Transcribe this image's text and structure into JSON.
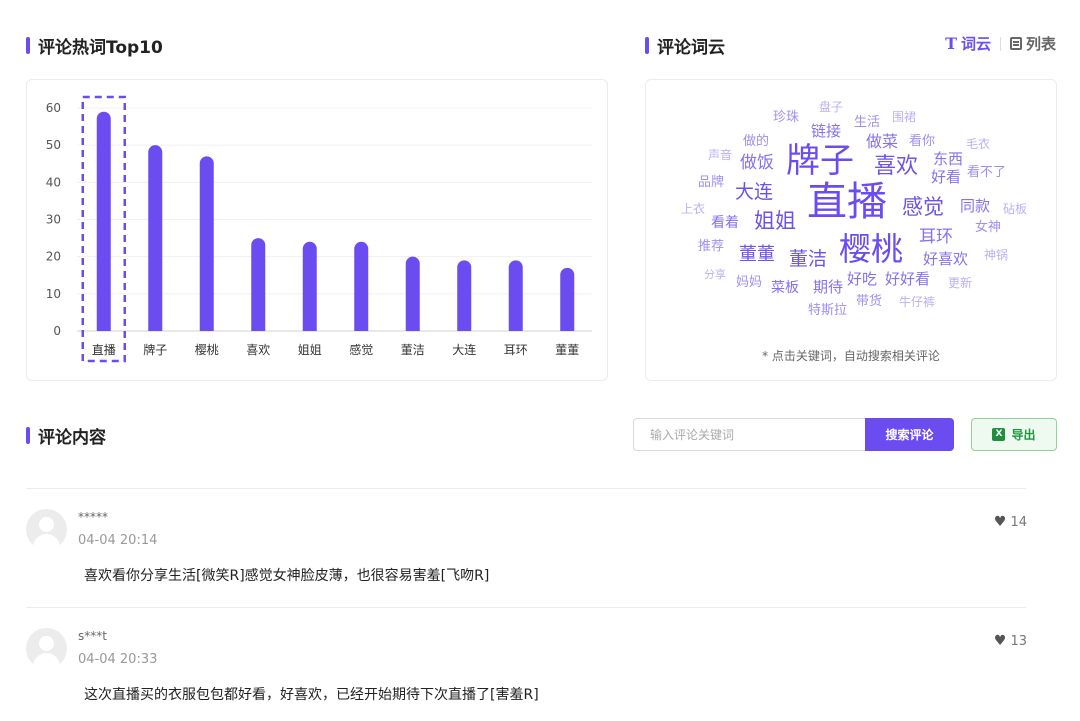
{
  "colors": {
    "accent": "#6a4cf0",
    "export_green": "#1a9a3c"
  },
  "top10": {
    "title": "评论热词Top10",
    "chart_data": {
      "type": "bar",
      "categories": [
        "直播",
        "牌子",
        "樱桃",
        "喜欢",
        "姐姐",
        "感觉",
        "董洁",
        "大连",
        "耳环",
        "董董"
      ],
      "values": [
        59,
        50,
        47,
        25,
        24,
        24,
        20,
        19,
        19,
        17
      ],
      "yticks": [
        0,
        10,
        20,
        30,
        40,
        50,
        60
      ],
      "ylim": [
        0,
        60
      ],
      "highlighted_category": "直播",
      "bar_color": "#6a4cf0",
      "grid": true
    }
  },
  "cloud": {
    "title": "评论词云",
    "toggle": {
      "cloud_label": "词云",
      "list_label": "列表",
      "active": "cloud",
      "cloud_icon": "T",
      "list_icon": "list-icon"
    },
    "note": "* 点击关键词，自动搜索相关评论",
    "words": [
      {
        "text": "直播",
        "size": 40,
        "weight": 5
      },
      {
        "text": "牌子",
        "size": 34,
        "weight": 5
      },
      {
        "text": "樱桃",
        "size": 32,
        "weight": 5
      },
      {
        "text": "喜欢",
        "size": 22,
        "weight": 4
      },
      {
        "text": "感觉",
        "size": 21,
        "weight": 4
      },
      {
        "text": "姐姐",
        "size": 21,
        "weight": 4
      },
      {
        "text": "大连",
        "size": 19,
        "weight": 4
      },
      {
        "text": "董洁",
        "size": 19,
        "weight": 4
      },
      {
        "text": "董董",
        "size": 18,
        "weight": 4
      },
      {
        "text": "耳环",
        "size": 17,
        "weight": 3
      },
      {
        "text": "做饭",
        "size": 17,
        "weight": 3
      },
      {
        "text": "做菜",
        "size": 16,
        "weight": 3
      },
      {
        "text": "好看",
        "size": 15,
        "weight": 3
      },
      {
        "text": "好喜欢",
        "size": 15,
        "weight": 3
      },
      {
        "text": "东西",
        "size": 15,
        "weight": 3
      },
      {
        "text": "链接",
        "size": 15,
        "weight": 3
      },
      {
        "text": "好吃",
        "size": 15,
        "weight": 3
      },
      {
        "text": "好好看",
        "size": 15,
        "weight": 3
      },
      {
        "text": "期待",
        "size": 15,
        "weight": 3
      },
      {
        "text": "同款",
        "size": 15,
        "weight": 3
      },
      {
        "text": "看着",
        "size": 14,
        "weight": 3
      },
      {
        "text": "菜板",
        "size": 14,
        "weight": 3
      },
      {
        "text": "看你",
        "size": 13,
        "weight": 2
      },
      {
        "text": "做的",
        "size": 13,
        "weight": 2
      },
      {
        "text": "女神",
        "size": 13,
        "weight": 2
      },
      {
        "text": "妈妈",
        "size": 13,
        "weight": 2
      },
      {
        "text": "推荐",
        "size": 13,
        "weight": 2
      },
      {
        "text": "品牌",
        "size": 13,
        "weight": 2
      },
      {
        "text": "带货",
        "size": 13,
        "weight": 2
      },
      {
        "text": "生活",
        "size": 13,
        "weight": 2
      },
      {
        "text": "珍珠",
        "size": 13,
        "weight": 2
      },
      {
        "text": "看不了",
        "size": 13,
        "weight": 2
      },
      {
        "text": "特斯拉",
        "size": 13,
        "weight": 2
      },
      {
        "text": "声音",
        "size": 12,
        "weight": 1
      },
      {
        "text": "盘子",
        "size": 12,
        "weight": 1
      },
      {
        "text": "围裙",
        "size": 12,
        "weight": 1
      },
      {
        "text": "毛衣",
        "size": 12,
        "weight": 1
      },
      {
        "text": "上衣",
        "size": 12,
        "weight": 1
      },
      {
        "text": "砧板",
        "size": 12,
        "weight": 1
      },
      {
        "text": "神锅",
        "size": 12,
        "weight": 1
      },
      {
        "text": "更新",
        "size": 12,
        "weight": 1
      },
      {
        "text": "牛仔裤",
        "size": 12,
        "weight": 1
      },
      {
        "text": "分享",
        "size": 11,
        "weight": 1
      }
    ]
  },
  "comments_section": {
    "title": "评论内容",
    "search_placeholder": "输入评论关键词",
    "search_button": "搜索评论",
    "export_button": "导出",
    "items": [
      {
        "user": "*****",
        "time": "04-04 20:14",
        "text": "喜欢看你分享生活[微笑R]感觉女神脸皮薄，也很容易害羞[飞吻R]",
        "likes": "14"
      },
      {
        "user": "s***t",
        "time": "04-04 20:33",
        "text": "这次直播买的衣服包包都好看，好喜欢，已经开始期待下次直播了[害羞R]",
        "likes": "13"
      }
    ]
  }
}
